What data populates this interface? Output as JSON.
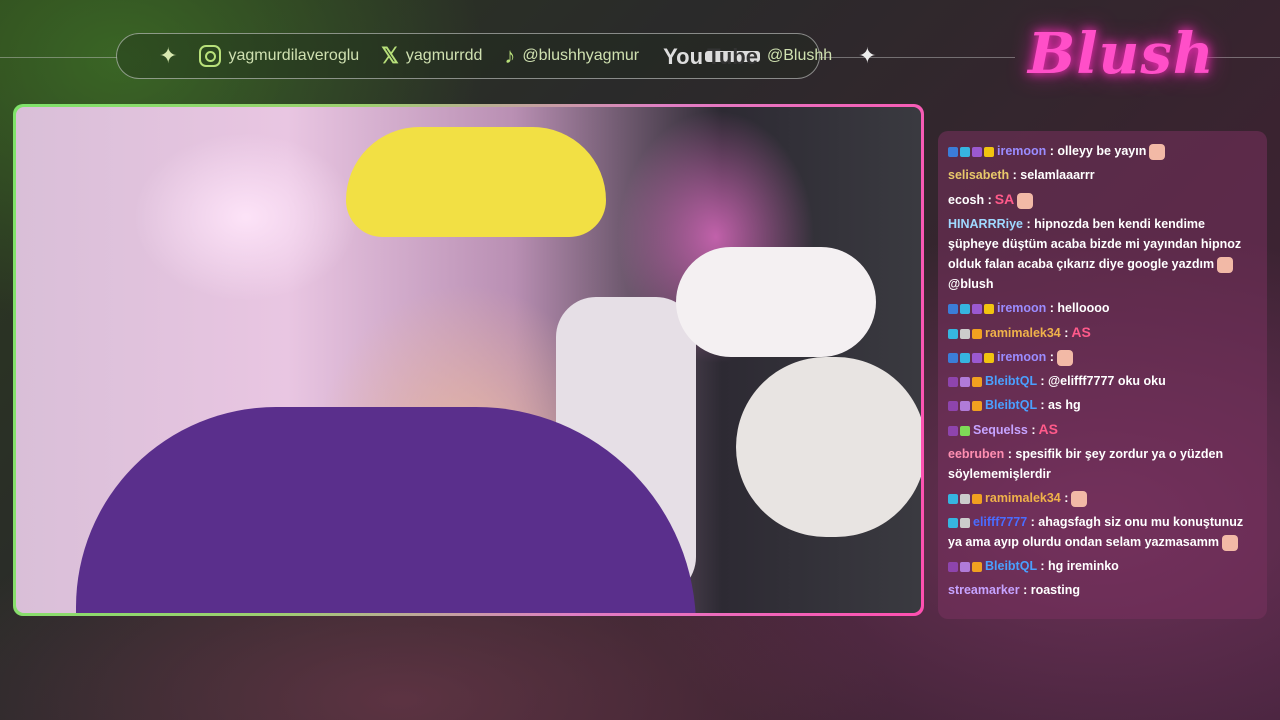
{
  "socials": [
    {
      "icon": "instagram-icon",
      "handle": "yagmurdilaveroglu"
    },
    {
      "icon": "x-icon",
      "handle": "yagmurrdd"
    },
    {
      "icon": "tiktok-icon",
      "handle": "@blushhyagmur"
    },
    {
      "icon": "youtube-icon",
      "handle": "@Blushh",
      "icon_text_top": "You",
      "icon_text_bottom": "Tube"
    }
  ],
  "logo": "Blush",
  "chat": [
    {
      "user": "iremoon",
      "color": "#9b8cff",
      "text": ": olleyy be yayın",
      "badges": [
        "#3b7dd8",
        "#36b5e0",
        "#9b59d0",
        "#f1c40f"
      ],
      "emote": true
    },
    {
      "user": "selisabeth",
      "color": "#e8c86a",
      "text": ": selamlaaarrr",
      "badges": []
    },
    {
      "user": "ecosh",
      "color": "#ffffff",
      "text": " :",
      "badges": [],
      "emote_text": "SA",
      "emote": true
    },
    {
      "user": "HINARRRiye",
      "color": "#9fd8ff",
      "text": ": hipnozda ben kendi kendime şüpheye düştüm acaba bizde mi yayından hipnoz olduk falan acaba çıkarız diye google yazdım",
      "badges": [],
      "emote": true,
      "tail": "@blush"
    },
    {
      "user": "iremoon",
      "color": "#9b8cff",
      "text": ": helloooo",
      "badges": [
        "#3b7dd8",
        "#36b5e0",
        "#9b59d0",
        "#f1c40f"
      ]
    },
    {
      "user": "ramimalek34",
      "color": "#f0b24a",
      "text": ":",
      "badges": [
        "#36b5e0",
        "#cccccc",
        "#f1a020"
      ],
      "emote_text": "AS"
    },
    {
      "user": "iremoon",
      "color": "#9b8cff",
      "text": ":",
      "badges": [
        "#3b7dd8",
        "#36b5e0",
        "#9b59d0",
        "#f1c40f"
      ],
      "emote": true
    },
    {
      "user": "BleibtQL",
      "color": "#4aa0ff",
      "text": ": @elifff7777 oku oku",
      "badges": [
        "#8e44ad",
        "#b07bd8",
        "#f1a020"
      ]
    },
    {
      "user": "BleibtQL",
      "color": "#4aa0ff",
      "text": ": as hg",
      "badges": [
        "#8e44ad",
        "#b07bd8",
        "#f1a020"
      ]
    },
    {
      "user": "Sequelss",
      "color": "#c6a3ff",
      "text": ":",
      "badges": [
        "#8e44ad",
        "#7ed957"
      ],
      "emote_text": "AS"
    },
    {
      "user": "eebruben",
      "color": "#ff8fb1",
      "text": ": spesifik bir şey zordur ya o yüzden söylememişlerdir",
      "badges": []
    },
    {
      "user": "ramimalek34",
      "color": "#f0b24a",
      "text": ":",
      "badges": [
        "#36b5e0",
        "#cccccc",
        "#f1a020"
      ],
      "emote": true
    },
    {
      "user": "elifff7777",
      "color": "#4a6cff",
      "text": ": ahagsfagh siz onu mu konuştunuz ya ama ayıp olurdu ondan selam yazmasamm",
      "badges": [
        "#36b5e0",
        "#cccccc"
      ],
      "emote": true
    },
    {
      "user": "BleibtQL",
      "color": "#4aa0ff",
      "text": ": hg ireminko",
      "badges": [
        "#8e44ad",
        "#b07bd8",
        "#f1a020"
      ]
    },
    {
      "user": "streamarker",
      "color": "#c6a3ff",
      "text": ": roasting",
      "badges": []
    }
  ]
}
